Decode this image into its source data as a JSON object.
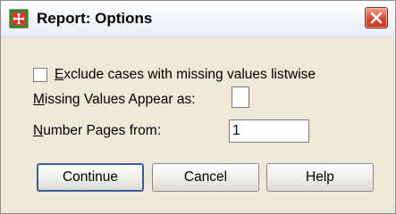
{
  "window": {
    "title": "Report: Options",
    "close_icon": "close-icon"
  },
  "options": {
    "exclude_listwise": {
      "label_prefix": "E",
      "label_rest": "xclude cases with missing values listwise",
      "checked": false
    },
    "missing_values": {
      "label_prefix": "M",
      "label_rest": "issing Values Appear as:",
      "value": ""
    },
    "number_pages": {
      "label_prefix": "N",
      "label_rest": "umber Pages from:",
      "value": "1"
    }
  },
  "buttons": {
    "continue": "Continue",
    "cancel": "Cancel",
    "help": "Help"
  },
  "colors": {
    "accent": "#3b5c9e",
    "close": "#d9472c"
  }
}
